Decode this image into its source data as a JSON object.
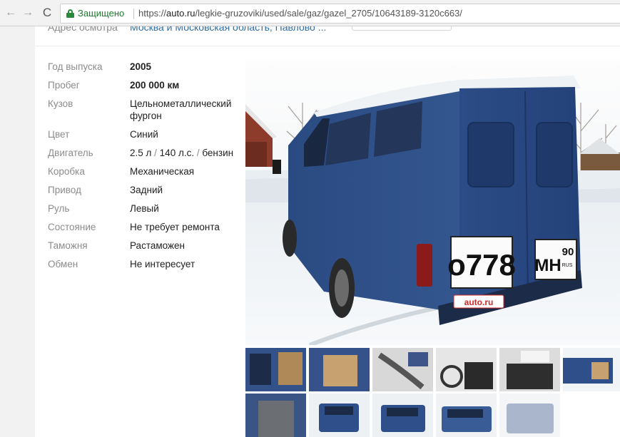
{
  "browser": {
    "back_icon": "←",
    "forward_icon": "→",
    "reload_icon": "C",
    "secure_label": "Защищено",
    "url_scheme": "https://",
    "url_host": "auto.ru",
    "url_path": "/legkie-gruzoviki/used/sale/gaz/gazel_2705/10643189-3120c663/"
  },
  "prev_row": {
    "label": "Адрес осмотра",
    "value": "Москва и Московская область, Павлово ..."
  },
  "specs": [
    {
      "label": "Год выпуска",
      "value": "2005"
    },
    {
      "label": "Пробег",
      "value": "200 000 км"
    },
    {
      "label": "Кузов",
      "value": "Цельнометаллический фургон"
    },
    {
      "label": "Цвет",
      "value": "Синий"
    },
    {
      "label": "Двигатель",
      "value_parts": [
        "2.5 л",
        "140 л.с.",
        "бензин"
      ],
      "sep": " / "
    },
    {
      "label": "Коробка",
      "value": "Механическая"
    },
    {
      "label": "Привод",
      "value": "Задний"
    },
    {
      "label": "Руль",
      "value": "Левый"
    },
    {
      "label": "Состояние",
      "value": "Не требует ремонта"
    },
    {
      "label": "Таможня",
      "value": "Растаможен"
    },
    {
      "label": "Обмен",
      "value": "Не интересует"
    }
  ],
  "photo": {
    "plate_number": "о778",
    "plate_region_letters": "МН",
    "plate_region_code": "90",
    "plate_country": "RUS",
    "dealer_badge": "auto.ru"
  },
  "colors": {
    "van_blue": "#2f4f8a",
    "secure_green": "#1f7a2e",
    "link_blue": "#2f6ea5"
  }
}
